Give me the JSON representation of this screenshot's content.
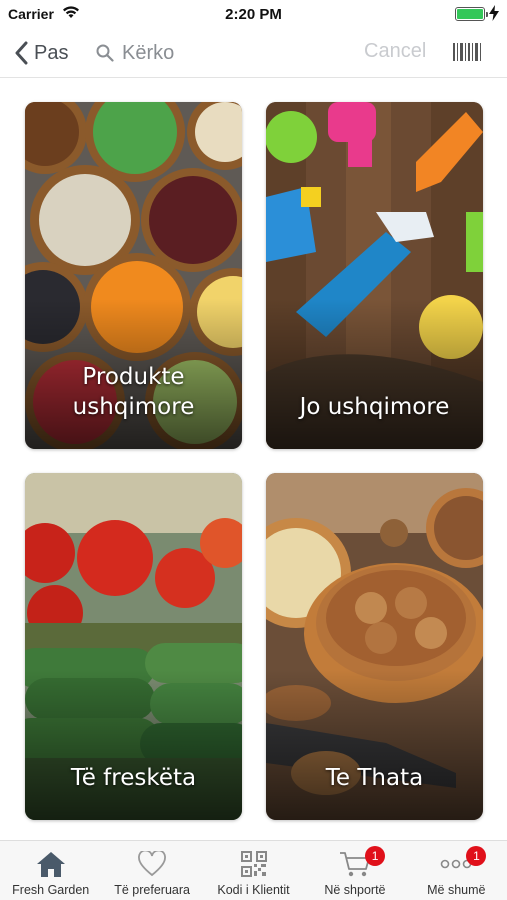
{
  "status_bar": {
    "carrier": "Carrier",
    "time": "2:20 PM",
    "battery_color": "#34c759"
  },
  "nav": {
    "back_label": "Pas",
    "search_placeholder": "Kërko",
    "cancel_label": "Cancel",
    "back_icon": "chevron-left-icon",
    "search_icon": "search-icon",
    "barcode_icon": "barcode-icon"
  },
  "categories": [
    {
      "label": "Produkte\nushqimore"
    },
    {
      "label": "Jo ushqimore"
    },
    {
      "label": "Të freskëta"
    },
    {
      "label": "Te Thata"
    }
  ],
  "tabs": [
    {
      "label": "Fresh Garden",
      "icon": "home-icon",
      "active_color": "#4a5a6a"
    },
    {
      "label": "Të preferuara",
      "icon": "heart-icon"
    },
    {
      "label": "Kodi i Klientit",
      "icon": "qr-code-icon"
    },
    {
      "label": "Në shportë",
      "icon": "cart-icon",
      "badge": "1"
    },
    {
      "label": "Më shumë",
      "icon": "more-icon",
      "badge": "1"
    }
  ],
  "badge_color": "#e0101a"
}
